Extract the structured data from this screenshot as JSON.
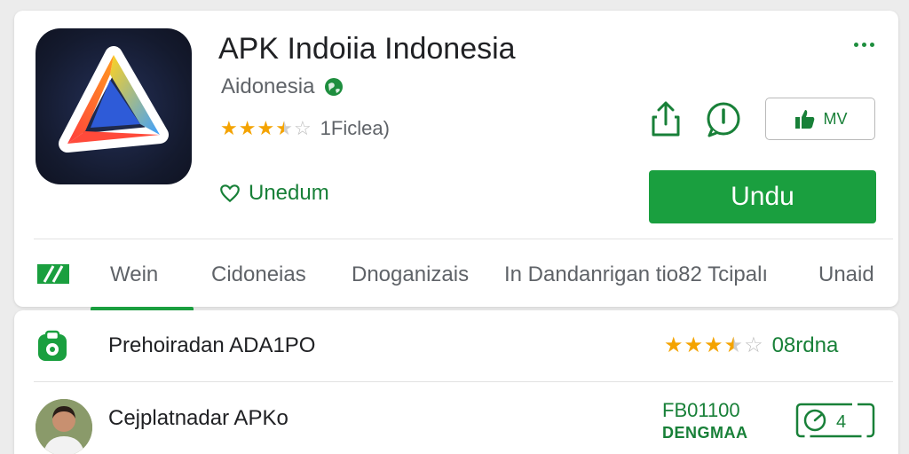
{
  "app": {
    "title": "APK Indoiia Indonesia",
    "developer": "Aidonesia",
    "rating_stars": 3.5,
    "rating_count": "1Ficlea)",
    "wishlist_label": "Unedum",
    "install_label": "Undu",
    "like_label": "MV"
  },
  "tabs": [
    {
      "label": "Wein",
      "active": true
    },
    {
      "label": "Cidoneias",
      "active": false
    },
    {
      "label": "Dnoganizais",
      "active": false
    },
    {
      "label": "In Dandanrigan tio82 Tcipalı",
      "active": false
    },
    {
      "label": "Unaid",
      "active": false
    }
  ],
  "list": [
    {
      "title": "Prehoiradan ADA1PO",
      "rating_stars": 3.5,
      "count": "08rdna",
      "icon": "store-badge-icon"
    },
    {
      "title": "Cejplatnadar APKo",
      "meta_line1": "FB01100",
      "meta_line2": "DENGMAA",
      "icon": "avatar"
    }
  ],
  "colors": {
    "accent_green": "#1a9f3f",
    "text_green": "#188038",
    "star_gold": "#f4a300",
    "background": "#ececec"
  },
  "icons": [
    "globe-icon",
    "heart-icon",
    "more-icon",
    "share-icon",
    "info-icon",
    "thumbs-up-icon",
    "tab-grid-icon",
    "store-badge-icon",
    "gauge-icon"
  ]
}
